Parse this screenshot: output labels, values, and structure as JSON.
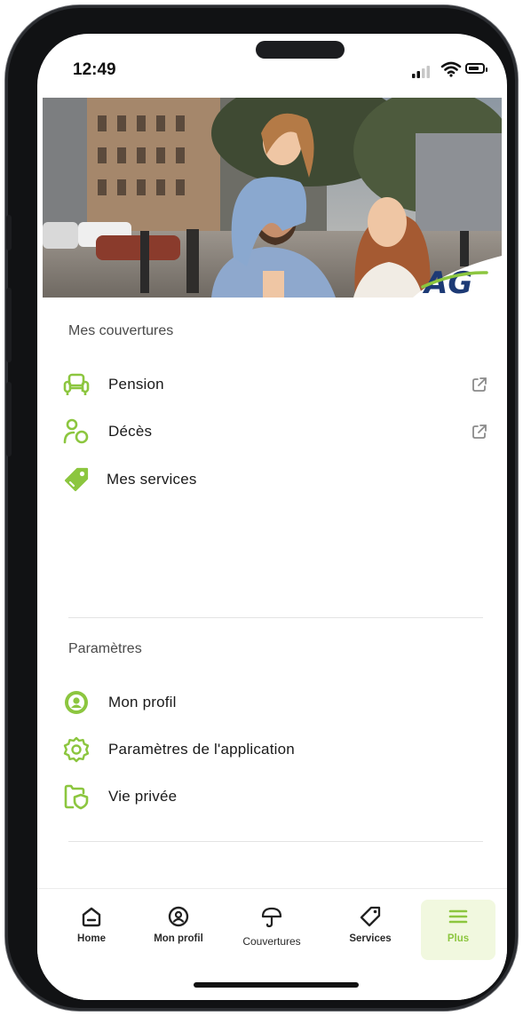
{
  "status_bar": {
    "time": "12:49"
  },
  "brand": {
    "logo_text": "AG",
    "accent": "#8cc63f",
    "navy": "#1d3a75"
  },
  "coverages": {
    "title": "Mes couvertures",
    "items": [
      {
        "label": "Pension",
        "icon": "armchair-icon",
        "external": true
      },
      {
        "label": "Décès",
        "icon": "people-icon",
        "external": true
      },
      {
        "label": "Mes services",
        "icon": "tag-icon",
        "external": false
      }
    ]
  },
  "settings": {
    "title": "Paramètres",
    "items": [
      {
        "label": "Mon profil",
        "icon": "user-circle-icon"
      },
      {
        "label": "Paramètres de l'application",
        "icon": "gear-icon"
      },
      {
        "label": "Vie privée",
        "icon": "privacy-shield-icon"
      }
    ]
  },
  "tabbar": {
    "items": [
      {
        "label": "Home",
        "icon": "home-icon"
      },
      {
        "label": "Mon profil",
        "icon": "user-circle-icon"
      },
      {
        "label": "Couvertures",
        "icon": "umbrella-icon"
      },
      {
        "label": "Services",
        "icon": "tag-icon"
      },
      {
        "label": "Plus",
        "icon": "menu-icon",
        "active": true
      }
    ]
  }
}
